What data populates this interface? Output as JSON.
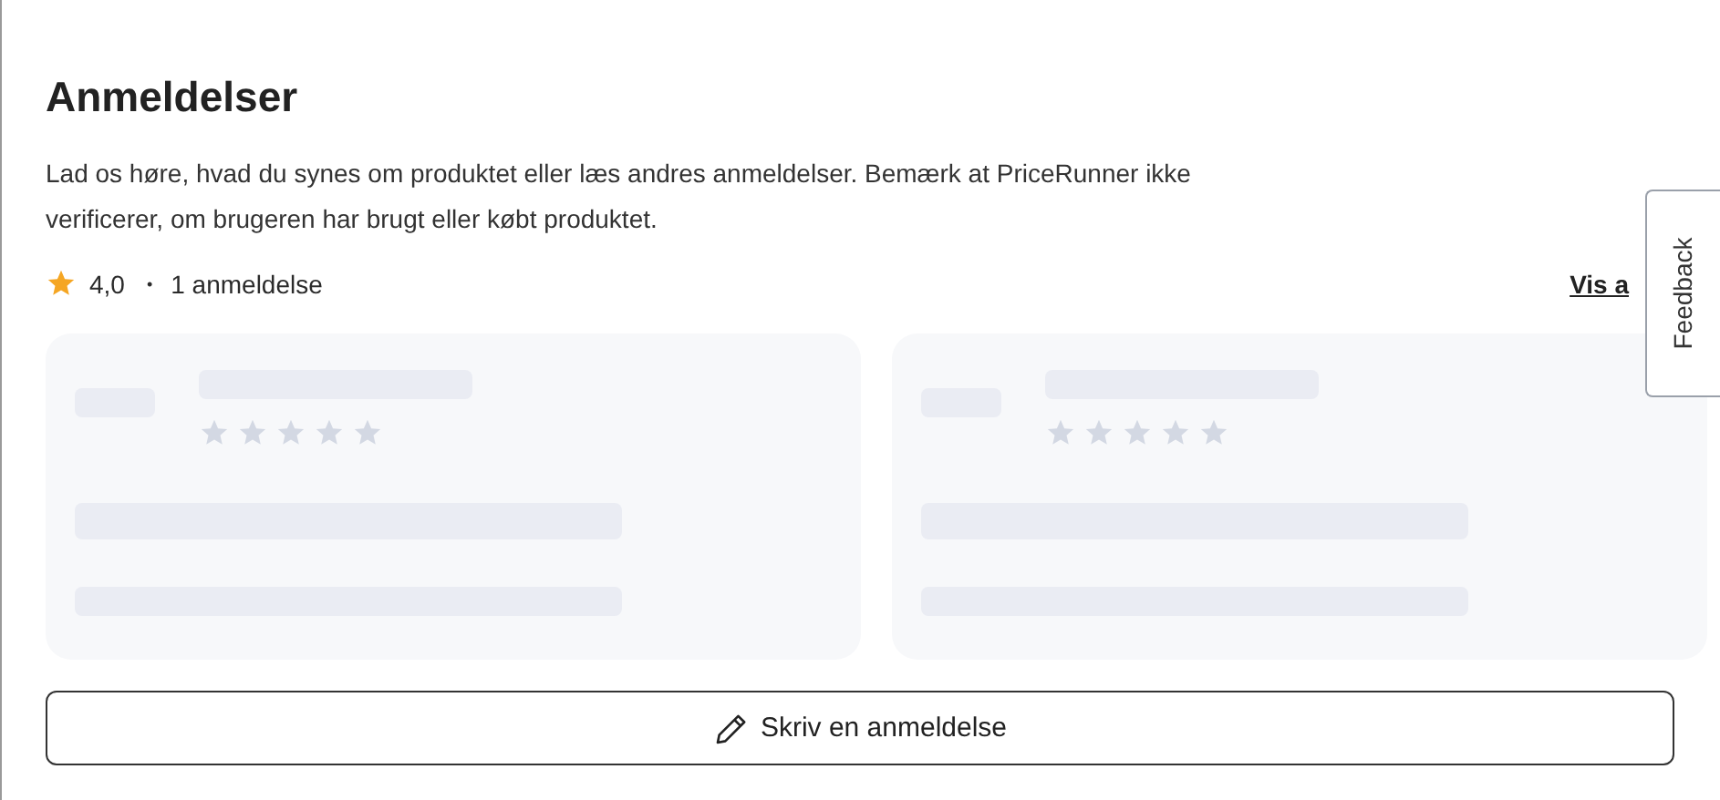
{
  "section": {
    "title": "Anmeldelser",
    "description": "Lad os høre, hvad du synes om produktet eller læs andres anmeldelser. Bemærk at PriceRunner ikke verificerer, om brugeren har brugt eller købt produktet."
  },
  "rating": {
    "score": "4,0",
    "separator": "•",
    "count": "1 anmeldelse",
    "link": "Vis a"
  },
  "review_cards": [
    {
      "kind": "skeleton"
    },
    {
      "kind": "skeleton"
    }
  ],
  "write_button": {
    "label": "Skriv en anmeldelse"
  },
  "feedback_tab": {
    "label": "Feedback"
  }
}
